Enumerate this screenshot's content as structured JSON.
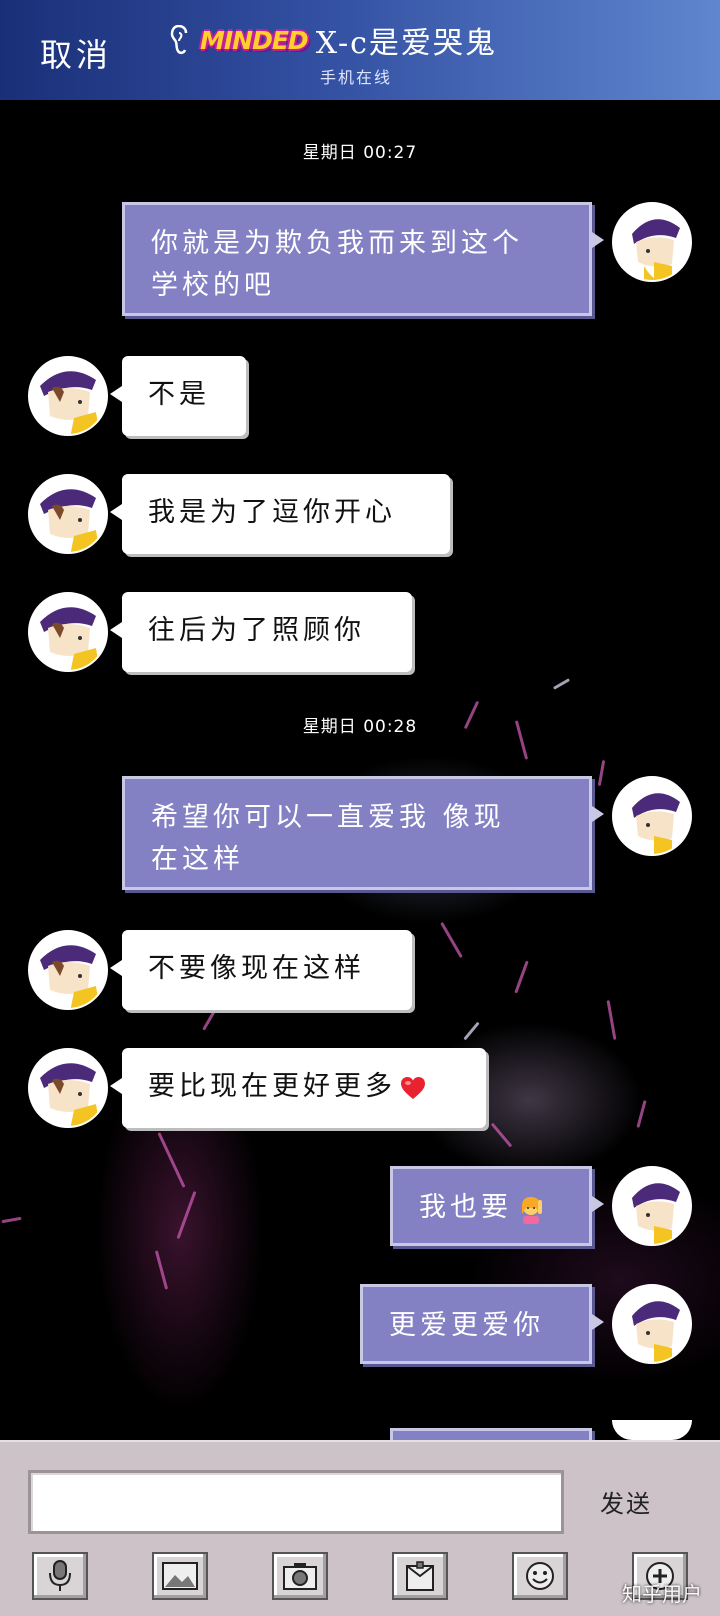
{
  "header": {
    "cancel_label": "取消",
    "brand_text": "MINDED",
    "contact_name": "X-c是爱哭鬼",
    "status": "手机在线"
  },
  "chat": {
    "timestamps": [
      "星期日  00:27",
      "星期日  00:28"
    ],
    "messages": [
      {
        "side": "out",
        "text_line1": "你就是为欺负我而来到这个",
        "text_line2": "学校的吧"
      },
      {
        "side": "in",
        "text": "不是"
      },
      {
        "side": "in",
        "text": "我是为了逗你开心"
      },
      {
        "side": "in",
        "text": "往后为了照顾你"
      },
      {
        "side": "out",
        "text_line1": "希望你可以一直爱我 像现",
        "text_line2": "在这样"
      },
      {
        "side": "in",
        "text": "不要像现在这样"
      },
      {
        "side": "in",
        "text": "要比现在更好更多",
        "emoji": "red-heart"
      },
      {
        "side": "out",
        "text": "我也要",
        "emoji": "raising-hand-girl"
      },
      {
        "side": "out",
        "text": "更爱更爱你"
      }
    ]
  },
  "input_bar": {
    "input_value": "",
    "send_label": "发送",
    "tools": [
      "microphone-icon",
      "image-icon",
      "camera-icon",
      "folder-icon",
      "smiley-icon",
      "plus-icon"
    ]
  },
  "watermark": "知乎用户",
  "colors": {
    "header_start": "#1a2f78",
    "header_end": "#5f86cf",
    "outgoing_bubble": "#8381c3",
    "incoming_bubble": "#ffffff",
    "input_bar": "#ccc2c7"
  }
}
